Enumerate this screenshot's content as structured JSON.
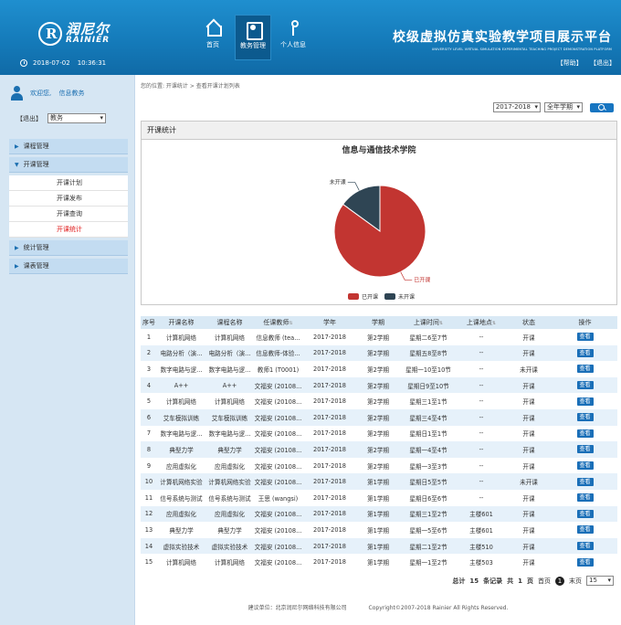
{
  "header": {
    "logo_cn": "润尼尔",
    "logo_en": "RAINIER",
    "date": "2018-07-02",
    "time": "10:36:31",
    "nav": [
      {
        "label": "首页",
        "icon": "home-icon",
        "active": false
      },
      {
        "label": "教务管理",
        "icon": "admin-icon",
        "active": true
      },
      {
        "label": "个人信息",
        "icon": "info-icon",
        "active": false
      }
    ],
    "title_cn": "校级虚拟仿真实验教学项目展示平台",
    "title_en": "UNIVERSITY LEVEL VIRTUAL SIMULATION EXPERIMENTAL TEACHING PROJECT DEMONSTRATION PLATFORM",
    "help_label": "【帮助】",
    "logout_label": "【退出】"
  },
  "sidebar": {
    "welcome": "欢迎您,",
    "user": "信息教务",
    "logout": "【退出】",
    "role": "教务",
    "menus": [
      {
        "label": "课程管理",
        "arrow": "▶",
        "children": []
      },
      {
        "label": "开课管理",
        "arrow": "▼",
        "children": [
          {
            "label": "开课计划",
            "active": false
          },
          {
            "label": "开课发布",
            "active": false
          },
          {
            "label": "开课查询",
            "active": false
          },
          {
            "label": "开课统计",
            "active": true
          }
        ]
      },
      {
        "label": "统计管理",
        "arrow": "▶",
        "children": []
      },
      {
        "label": "课表管理",
        "arrow": "▶",
        "children": []
      }
    ]
  },
  "main": {
    "breadcrumb": "您的位置: 开课统计 > 查看开课计划列表",
    "year": "2017-2018",
    "semester": "全年学期",
    "stats_title": "开课统计",
    "chart_title": "信息与通信技术学院",
    "pagination": {
      "total_prefix": "总计",
      "total": "15",
      "total_suffix": "条记录",
      "pages_prefix": "共",
      "pages": "1",
      "pages_suffix": "页",
      "first": "首页",
      "current": "1",
      "last": "末页",
      "page_size": "15"
    }
  },
  "chart_data": {
    "type": "pie",
    "title": "信息与通信技术学院",
    "slices": [
      {
        "label": "已开课",
        "value": 85,
        "color": "#c23531"
      },
      {
        "label": "未开课",
        "value": 15,
        "color": "#2f4554"
      }
    ],
    "legend": [
      "已开课",
      "未开课"
    ],
    "legend_position": "bottom"
  },
  "table": {
    "headers": [
      "序号",
      "开课名称",
      "课程名称",
      "任课教师",
      "学年",
      "学期",
      "上课时间",
      "上课地点",
      "状态",
      "操作"
    ],
    "sortable": [
      false,
      false,
      false,
      true,
      false,
      false,
      true,
      true,
      false,
      false
    ],
    "action_label": "查看",
    "rows": [
      [
        "1",
        "计算机网络",
        "计算机网络",
        "信息教师 (tea...",
        "2017-2018",
        "第2学期",
        "星期二6至7节",
        "--",
        "开课"
      ],
      [
        "2",
        "电路分析（演...",
        "电路分析（演...",
        "信息教师-体验...",
        "2017-2018",
        "第2学期",
        "星期五8至8节",
        "--",
        "开课"
      ],
      [
        "3",
        "数字电路与逻...",
        "数字电路与逻...",
        "教师1 (T0001)",
        "2017-2018",
        "第2学期",
        "星期一10至10节",
        "--",
        "未开课"
      ],
      [
        "4",
        "A++",
        "A++",
        "文福安 (20108...",
        "2017-2018",
        "第2学期",
        "星期日9至10节",
        "--",
        "开课"
      ],
      [
        "5",
        "计算机网络",
        "计算机网络",
        "文福安 (20108...",
        "2017-2018",
        "第2学期",
        "星期三1至1节",
        "--",
        "开课"
      ],
      [
        "6",
        "艾车模拟训练",
        "艾车模拟训练",
        "文福安 (20108...",
        "2017-2018",
        "第2学期",
        "星期三4至4节",
        "--",
        "开课"
      ],
      [
        "7",
        "数字电路与逻...",
        "数字电路与逻...",
        "文福安 (20108...",
        "2017-2018",
        "第2学期",
        "星期日1至1节",
        "--",
        "开课"
      ],
      [
        "8",
        "典型力学",
        "典型力学",
        "文福安 (20108...",
        "2017-2018",
        "第2学期",
        "星期一4至4节",
        "--",
        "开课"
      ],
      [
        "9",
        "应用虚拟化",
        "应用虚拟化",
        "文福安 (20108...",
        "2017-2018",
        "第2学期",
        "星期一3至3节",
        "--",
        "开课"
      ],
      [
        "10",
        "计算机网络实验",
        "计算机网络实验",
        "文福安 (20108...",
        "2017-2018",
        "第1学期",
        "星期日5至5节",
        "--",
        "未开课"
      ],
      [
        "11",
        "信号系统与测试",
        "信号系统与测试",
        "王思 (wangsi)",
        "2017-2018",
        "第1学期",
        "星期日6至6节",
        "--",
        "开课"
      ],
      [
        "12",
        "应用虚拟化",
        "应用虚拟化",
        "文福安 (20108...",
        "2017-2018",
        "第1学期",
        "星期三1至2节",
        "主楼601",
        "开课"
      ],
      [
        "13",
        "典型力学",
        "典型力学",
        "文福安 (20108...",
        "2017-2018",
        "第1学期",
        "星期一5至6节",
        "主楼601",
        "开课"
      ],
      [
        "14",
        "虚拟实验技术",
        "虚拟实验技术",
        "文福安 (20108...",
        "2017-2018",
        "第1学期",
        "星期二1至2节",
        "主楼510",
        "开课"
      ],
      [
        "15",
        "计算机网络",
        "计算机网络",
        "文福安 (20108...",
        "2017-2018",
        "第1学期",
        "星期一1至2节",
        "主楼503",
        "开课"
      ]
    ]
  },
  "footer": {
    "support": "建议单位：北京润尼尔网络科技有限公司",
    "copyright": "Copyright©2007-2018 Rainier All Rights Reserved."
  }
}
